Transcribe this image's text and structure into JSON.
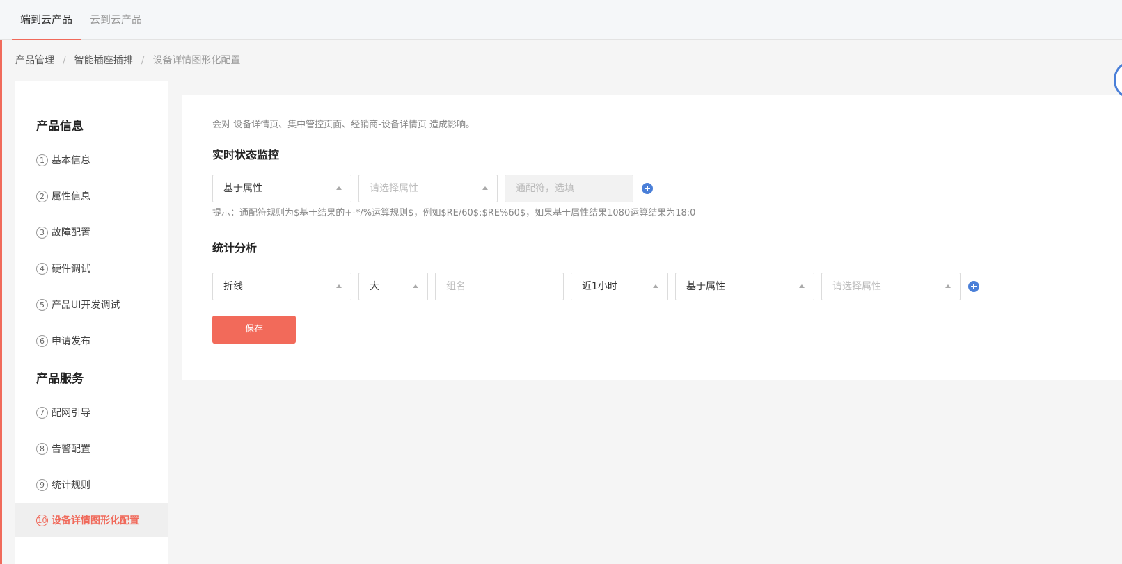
{
  "top_tabs": [
    {
      "label": "端到云产品",
      "active": true
    },
    {
      "label": "云到云产品",
      "active": false
    }
  ],
  "breadcrumb": [
    "产品管理",
    "智能插座插排",
    "设备详情图形化配置"
  ],
  "sidebar": {
    "sections": [
      {
        "heading": "产品信息",
        "items": [
          {
            "num": "1",
            "label": "基本信息"
          },
          {
            "num": "2",
            "label": "属性信息"
          },
          {
            "num": "3",
            "label": "故障配置"
          },
          {
            "num": "4",
            "label": "硬件调试"
          },
          {
            "num": "5",
            "label": "产品UI开发调试"
          },
          {
            "num": "6",
            "label": "申请发布"
          }
        ]
      },
      {
        "heading": "产品服务",
        "items": [
          {
            "num": "7",
            "label": "配网引导"
          },
          {
            "num": "8",
            "label": "告警配置"
          },
          {
            "num": "9",
            "label": "统计规则"
          },
          {
            "num": "10",
            "label": "设备详情图形化配置",
            "active": true
          }
        ]
      }
    ]
  },
  "main": {
    "hint_top": "会对 设备详情页、集中管控页面、经销商-设备详情页 造成影响。",
    "realtime": {
      "title": "实时状态监控",
      "source_select": "基于属性",
      "property_placeholder": "请选择属性",
      "wildcard_placeholder": "通配符，选填",
      "tip": "提示：通配符规则为$基于结果的+-*/%运算规则$，例如$RE/60$:$RE%60$，如果基于属性结果1080运算结果为18:0"
    },
    "stats": {
      "title": "统计分析",
      "chart_type": "折线",
      "size": "大",
      "group_placeholder": "组名",
      "time_range": "近1小时",
      "source_select": "基于属性",
      "property_placeholder": "请选择属性"
    },
    "save_label": "保存"
  },
  "colors": {
    "accent": "#f06a5b",
    "primary_blue": "#4a7fd8"
  }
}
